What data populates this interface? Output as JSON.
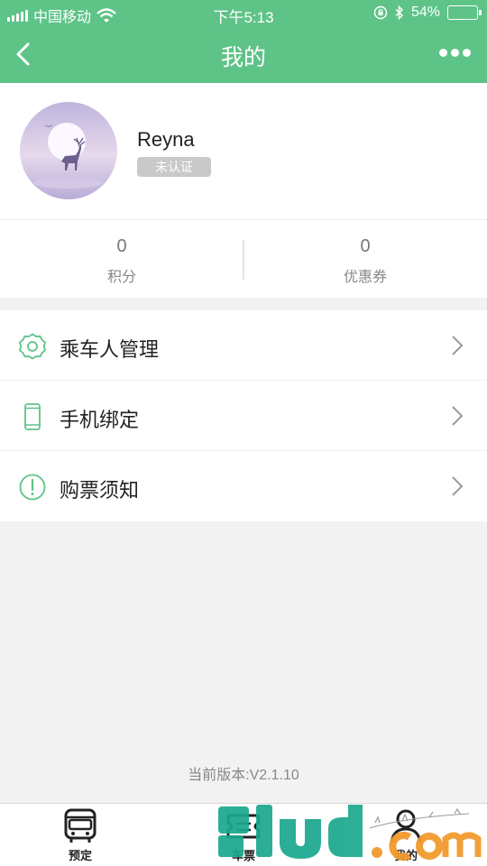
{
  "status_bar": {
    "carrier": "中国移动",
    "time": "下午5:13",
    "battery_percent": "54%",
    "battery_level": 0.54
  },
  "nav": {
    "title": "我的"
  },
  "profile": {
    "name": "Reyna",
    "badge": "未认证"
  },
  "stats": [
    {
      "value": "0",
      "label": "积分"
    },
    {
      "value": "0",
      "label": "优惠券"
    }
  ],
  "menu": [
    {
      "label": "乘车人管理",
      "icon": "gear-icon"
    },
    {
      "label": "手机绑定",
      "icon": "phone-icon"
    },
    {
      "label": "购票须知",
      "icon": "alert-circle-icon"
    }
  ],
  "version": "当前版本:V2.1.10",
  "tabs": [
    {
      "label": "预定",
      "icon": "bus-icon"
    },
    {
      "label": "车票",
      "icon": "ticket-icon"
    },
    {
      "label": "我的",
      "icon": "user-icon"
    }
  ],
  "watermark": {
    "text": "9lud.com",
    "handwriting": "山 xx 商店"
  },
  "colors": {
    "primary": "#5ec387",
    "watermark_teal": "#1aa88d",
    "watermark_orange": "#f29a2e"
  }
}
